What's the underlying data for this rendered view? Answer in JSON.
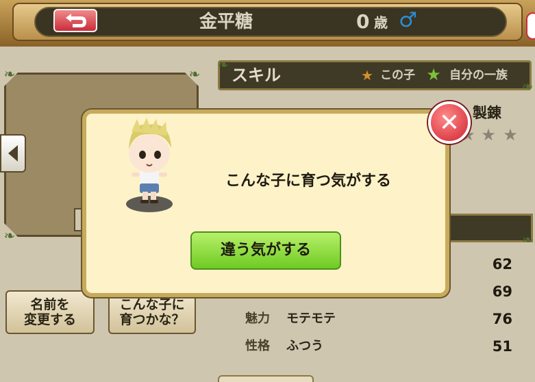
{
  "header": {
    "title": "金平糖",
    "age": "0",
    "age_unit": "歳",
    "gender_icon": "♂"
  },
  "skill_panel": {
    "title": "スキル",
    "legend_this_child": "この子",
    "legend_family": "自分の一族",
    "skill_name": "製錬"
  },
  "stats": [
    {
      "label": "",
      "value": "",
      "number": "62"
    },
    {
      "label": "",
      "value": "",
      "number": "69"
    },
    {
      "label": "魅力",
      "value": "モテモテ",
      "number": "76"
    },
    {
      "label": "性格",
      "value": "ふつう",
      "number": "51"
    }
  ],
  "buttons": {
    "rename": "名前を\n変更する",
    "grow_like": "こんな子に\n育つかな？"
  },
  "dialog": {
    "message": "こんな子に育つ気がする",
    "confirm_label": "違う気がする"
  },
  "colors": {
    "accent_green": "#6fca23",
    "close_red": "#d0232f",
    "gender_blue": "#2a8fd6"
  }
}
